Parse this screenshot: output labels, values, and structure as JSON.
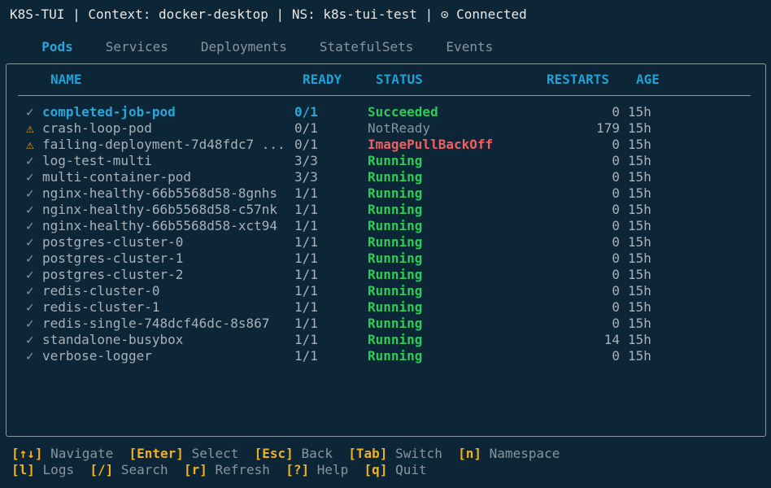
{
  "header": {
    "app": "K8S-TUI",
    "context": "Context: docker-desktop",
    "namespace": "NS: k8s-tui-test",
    "connection": "⊙ Connected"
  },
  "tabs": [
    "Pods",
    "Services",
    "Deployments",
    "StatefulSets",
    "Events"
  ],
  "active_tab": "Pods",
  "columns": {
    "name": "NAME",
    "ready": "READY",
    "status": "STATUS",
    "restarts": "RESTARTS",
    "age": "AGE"
  },
  "pods": [
    {
      "icon": "✓",
      "name": "completed-job-pod",
      "ready": "0/1",
      "status": "Succeeded",
      "restarts": "0",
      "age": "15h"
    },
    {
      "icon": "⚠",
      "name": "crash-loop-pod",
      "ready": "0/1",
      "status": "NotReady",
      "restarts": "179",
      "age": "15h"
    },
    {
      "icon": "⚠",
      "name": "failing-deployment-7d48fdc7 ...",
      "ready": "0/1",
      "status": "ImagePullBackOff",
      "restarts": "0",
      "age": "15h"
    },
    {
      "icon": "✓",
      "name": "log-test-multi",
      "ready": "3/3",
      "status": "Running",
      "restarts": "0",
      "age": "15h"
    },
    {
      "icon": "✓",
      "name": "multi-container-pod",
      "ready": "3/3",
      "status": "Running",
      "restarts": "0",
      "age": "15h"
    },
    {
      "icon": "✓",
      "name": "nginx-healthy-66b5568d58-8gnhs",
      "ready": "1/1",
      "status": "Running",
      "restarts": "0",
      "age": "15h"
    },
    {
      "icon": "✓",
      "name": "nginx-healthy-66b5568d58-c57nk",
      "ready": "1/1",
      "status": "Running",
      "restarts": "0",
      "age": "15h"
    },
    {
      "icon": "✓",
      "name": "nginx-healthy-66b5568d58-xct94",
      "ready": "1/1",
      "status": "Running",
      "restarts": "0",
      "age": "15h"
    },
    {
      "icon": "✓",
      "name": "postgres-cluster-0",
      "ready": "1/1",
      "status": "Running",
      "restarts": "0",
      "age": "15h"
    },
    {
      "icon": "✓",
      "name": "postgres-cluster-1",
      "ready": "1/1",
      "status": "Running",
      "restarts": "0",
      "age": "15h"
    },
    {
      "icon": "✓",
      "name": "postgres-cluster-2",
      "ready": "1/1",
      "status": "Running",
      "restarts": "0",
      "age": "15h"
    },
    {
      "icon": "✓",
      "name": "redis-cluster-0",
      "ready": "1/1",
      "status": "Running",
      "restarts": "0",
      "age": "15h"
    },
    {
      "icon": "✓",
      "name": "redis-cluster-1",
      "ready": "1/1",
      "status": "Running",
      "restarts": "0",
      "age": "15h"
    },
    {
      "icon": "✓",
      "name": "redis-single-748dcf46dc-8s867",
      "ready": "1/1",
      "status": "Running",
      "restarts": "0",
      "age": "15h"
    },
    {
      "icon": "✓",
      "name": "standalone-busybox",
      "ready": "1/1",
      "status": "Running",
      "restarts": "14",
      "age": "15h"
    },
    {
      "icon": "✓",
      "name": "verbose-logger",
      "ready": "1/1",
      "status": "Running",
      "restarts": "0",
      "age": "15h"
    }
  ],
  "help_line_1": [
    {
      "key": "[↑↓]",
      "desc": "Navigate"
    },
    {
      "key": "[Enter]",
      "desc": "Select"
    },
    {
      "key": "[Esc]",
      "desc": "Back"
    },
    {
      "key": "[Tab]",
      "desc": "Switch"
    },
    {
      "key": "[n]",
      "desc": "Namespace"
    }
  ],
  "help_line_2": [
    {
      "key": "[l]",
      "desc": "Logs"
    },
    {
      "key": "[/]",
      "desc": "Search"
    },
    {
      "key": "[r]",
      "desc": "Refresh"
    },
    {
      "key": "[?]",
      "desc": "Help"
    },
    {
      "key": "[q]",
      "desc": "Quit"
    }
  ],
  "colors": {
    "background": "#0c2537",
    "accent": "#29a7d8",
    "running": "#2ecc55",
    "error": "#f06060",
    "key": "#f0b020"
  }
}
